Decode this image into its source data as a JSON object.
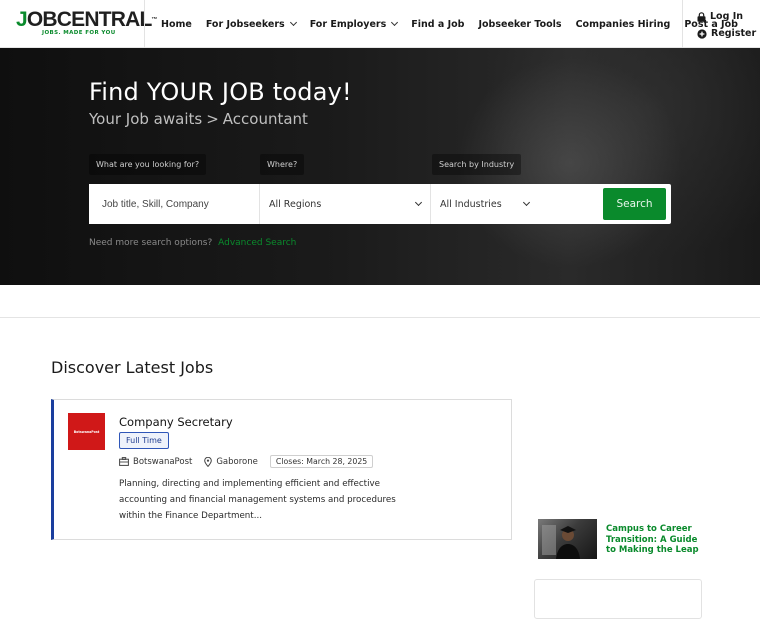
{
  "header": {
    "logo": {
      "name": "JOBCENTRAL",
      "tagline": "JOBS. MADE FOR YOU"
    },
    "nav": [
      {
        "label": "Home",
        "has_dropdown": false
      },
      {
        "label": "For Jobseekers",
        "has_dropdown": true
      },
      {
        "label": "For Employers",
        "has_dropdown": true
      },
      {
        "label": "Find a Job",
        "has_dropdown": false
      },
      {
        "label": "Jobseeker Tools",
        "has_dropdown": false
      },
      {
        "label": "Companies Hiring",
        "has_dropdown": false
      },
      {
        "label": "Post a Job",
        "has_dropdown": false
      }
    ],
    "auth": {
      "login": {
        "label": "Log In",
        "icon": "lock-icon"
      },
      "register": {
        "label": "Register",
        "icon": "plus-circle-icon"
      }
    }
  },
  "hero": {
    "title": "Find YOUR JOB today!",
    "subtitle_prefix": "Your Job awaits",
    "subtitle_separator": ">",
    "subtitle_category": "Accountant",
    "labels": {
      "keyword": "What are you looking for?",
      "location": "Where?",
      "industry": "Search by Industry"
    },
    "search": {
      "keyword_placeholder": "Job title, Skill, Company",
      "region_value": "All Regions",
      "industry_value": "All Industries",
      "button_label": "Search"
    },
    "more_options_text": "Need more search options?",
    "advanced_link": "Advanced Search"
  },
  "main": {
    "section_title": "Discover Latest Jobs",
    "jobs": [
      {
        "title": "Company Secretary",
        "type": "Full Time",
        "company": "BotswanaPost",
        "location": "Gaborone",
        "closes": "Closes: March 28, 2025",
        "description": "Planning, directing and implementing efficient and effective accounting and financial management systems and procedures within the Finance Department...",
        "logo_text": "BotswanaPost"
      }
    ]
  },
  "sidebar": {
    "article_title": "Campus to Career Transition: A Guide to Making the Leap"
  },
  "colors": {
    "brand_green": "#0a8a2c",
    "card_accent_blue": "#1a3e9e",
    "logo_red": "#d01818"
  }
}
